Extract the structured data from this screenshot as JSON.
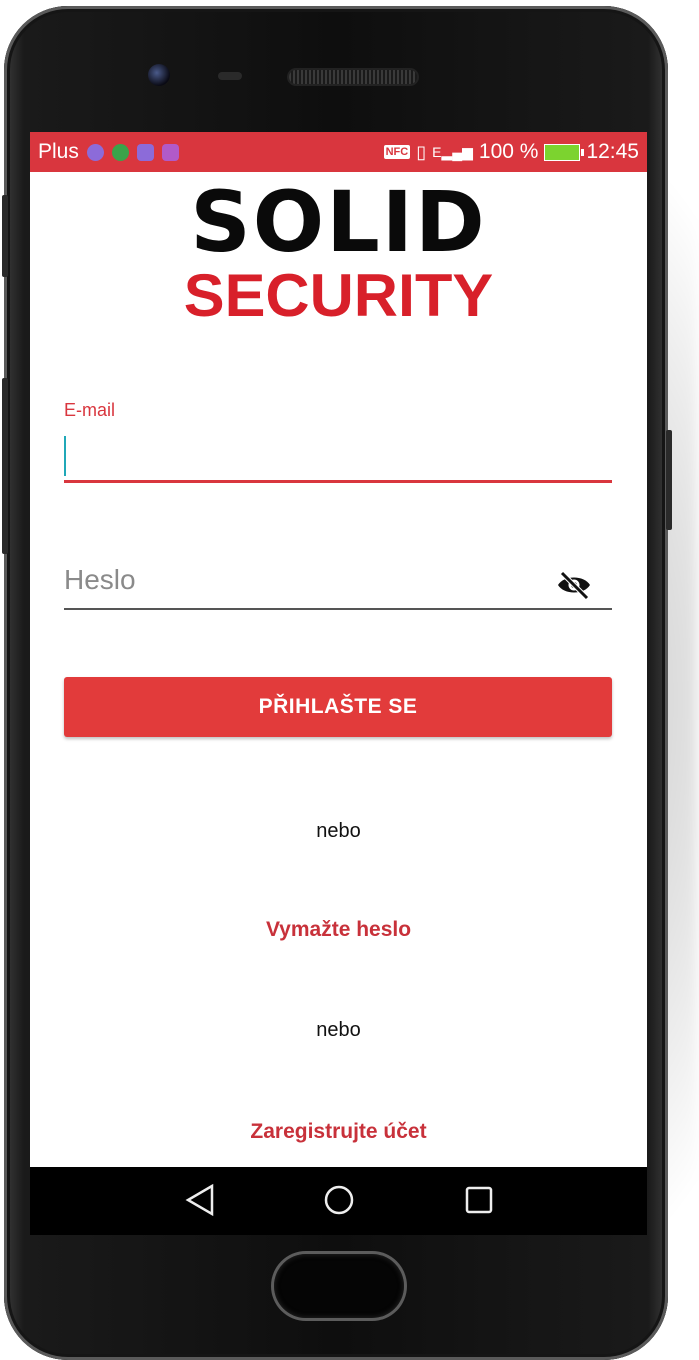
{
  "status_bar": {
    "carrier": "Plus",
    "nfc_label": "NFC",
    "signal_label": "E",
    "battery_percent": "100 %",
    "time": "12:45",
    "accent_color": "#d9363e"
  },
  "logo": {
    "line1": "SOLID",
    "line2": "SECURITY"
  },
  "form": {
    "email_label": "E-mail",
    "email_value": "",
    "password_placeholder": "Heslo",
    "password_toggle_icon": "eye-off-icon",
    "login_button": "PŘIHLAŠTE SE"
  },
  "links": {
    "or_1": "nebo",
    "reset_password": "Vymažte heslo",
    "or_2": "nebo",
    "register": "Zaregistrujte účet"
  },
  "nav_bar": {
    "back_icon": "back-triangle-icon",
    "home_icon": "home-circle-icon",
    "recents_icon": "recents-square-icon"
  }
}
